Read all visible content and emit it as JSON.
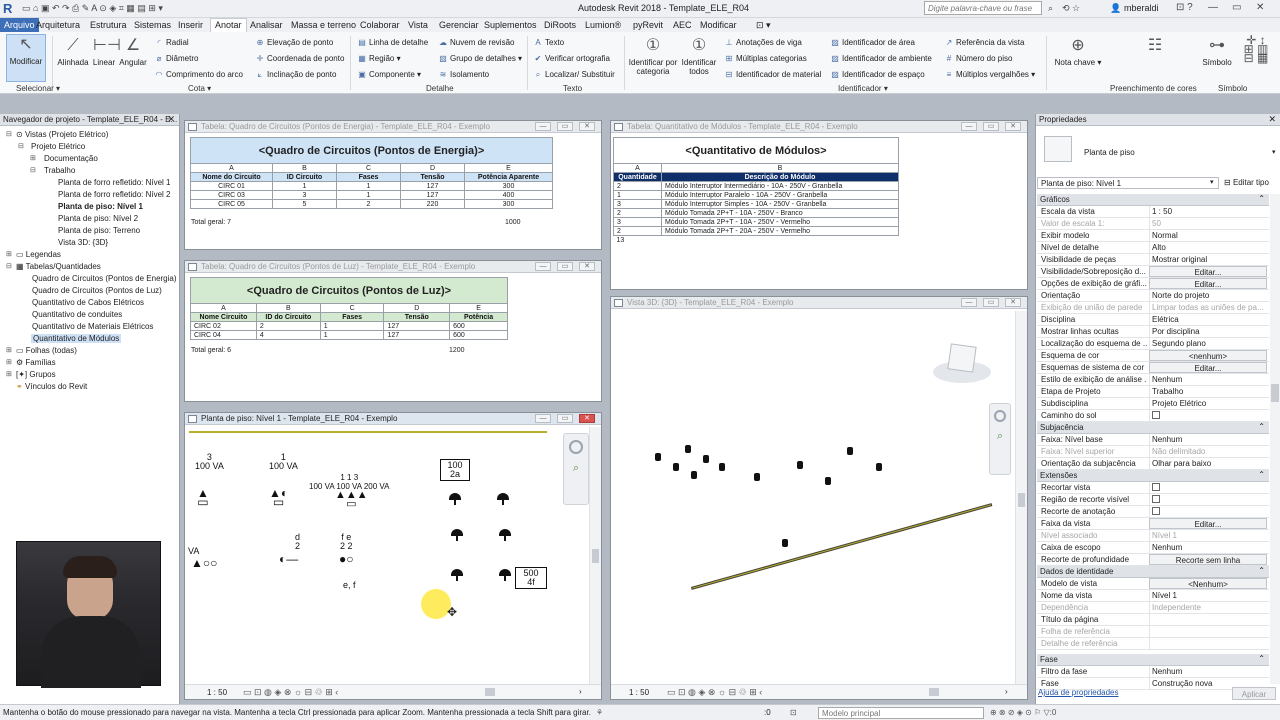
{
  "titlebar": {
    "app": "Autodesk Revit 2018 -",
    "file": "Template_ELE_R04",
    "search_placeholder": "Digite palavra-chave ou frase",
    "user": "mberaldi"
  },
  "tabs": [
    "Arquivo",
    "Arquitetura",
    "Estrutura",
    "Sistemas",
    "Inserir",
    "Anotar",
    "Analisar",
    "Massa e terreno",
    "Colaborar",
    "Vista",
    "Gerenciar",
    "Suplementos",
    "DiRoots",
    "Lumion®",
    "pyRevit",
    "AEC",
    "Modificar"
  ],
  "ribbon": {
    "modificar": "Modificar",
    "cota_btns": [
      "Alinhada",
      "Linear",
      "Angular"
    ],
    "cota_items": [
      "Radial",
      "Diâmetro",
      "Comprimento do arco",
      "Elevação de ponto",
      "Coordenada de ponto",
      "Inclinação de ponto"
    ],
    "detalhe_items": [
      "Linha de detalhe",
      "Região",
      "Componente",
      "Nuvem de revisão",
      "Grupo de detalhes",
      "Isolamento"
    ],
    "texto_items": [
      "Texto",
      "Verificar ortografia",
      "Localizar/ Substituir"
    ],
    "ident_btns": [
      "Identificar por categoria",
      "Identificar todos"
    ],
    "ident_items": [
      "Anotações de viga",
      "Múltiplas categorias",
      "Identificador de material",
      "Identificador de área",
      "Identificador de ambiente",
      "Identificador de espaço",
      "Referência da vista",
      "Número do piso",
      "Múltiplos vergalhões"
    ],
    "nota": "Nota chave",
    "simbolo": "Símbolo",
    "panels": [
      "Selecionar",
      "Cota",
      "Detalhe",
      "Texto",
      "Identificador",
      "Preenchimento de cores",
      "Símbolo"
    ]
  },
  "browser": {
    "title": "Navegador de projeto - Template_ELE_R04 - E...",
    "nodes": [
      "Vistas (Projeto Elétrico)",
      "Projeto Elétrico",
      "Documentação",
      "Trabalho",
      "Planta de forro refletido: Nível 1",
      "Planta de forro refletido: Nível 2",
      "Planta de piso: Nível 1",
      "Planta de piso: Nível 2",
      "Planta de piso: Terreno",
      "Vista 3D: {3D}",
      "Legendas",
      "Tabelas/Quantidades",
      "Quadro de Circuitos (Pontos de Energia)",
      "Quadro de Circuitos (Pontos de Luz)",
      "Quantitativo de Cabos Elétricos",
      "Quantitativo de conduites",
      "Quantitativo de Materiais Elétricos",
      "Quantitativo de Módulos",
      "Folhas (todas)",
      "Famílias",
      "Grupos",
      "Vínculos do Revit"
    ]
  },
  "view1": {
    "title": "Tabela: Quadro de Circuitos (Pontos de Energia) - Template_ELE_R04 - Exemplo",
    "caption": "<Quadro de Circuitos (Pontos de Energia)>",
    "letters": [
      "A",
      "B",
      "C",
      "D",
      "E"
    ],
    "headers": [
      "Nome do Circuito",
      "ID Circuito",
      "Fases",
      "Tensão",
      "Potência Aparente"
    ],
    "rows": [
      [
        "CIRC 01",
        "1",
        "1",
        "127",
        "300"
      ],
      [
        "CIRC 03",
        "3",
        "1",
        "127",
        "400"
      ],
      [
        "CIRC 05",
        "5",
        "2",
        "220",
        "300"
      ]
    ],
    "total_label": "Total geral: 7",
    "total_value": "1000",
    "color": "#cfe3f7"
  },
  "view2": {
    "title": "Tabela: Quadro de Circuitos (Pontos de Luz) - Template_ELE_R04 - Exemplo",
    "caption": "<Quadro de Circuitos (Pontos de Luz)>",
    "letters": [
      "A",
      "B",
      "C",
      "D",
      "E"
    ],
    "headers": [
      "Nome Circuito",
      "ID do Circuito",
      "Fases",
      "Tensão",
      "Potência"
    ],
    "rows": [
      [
        "CIRC 02",
        "2",
        "1",
        "127",
        "600"
      ],
      [
        "CIRC 04",
        "4",
        "1",
        "127",
        "600"
      ]
    ],
    "total_label": "Total geral: 6",
    "total_value": "1200",
    "color": "#d4ead0"
  },
  "view3": {
    "title": "Tabela: Quantitativo de Módulos - Template_ELE_R04 - Exemplo",
    "caption": "<Quantitativo de Módulos>",
    "letters": [
      "A",
      "B"
    ],
    "headers": [
      "Quantidade",
      "Descrição do Módulo"
    ],
    "rows": [
      [
        "2",
        "Módulo Interruptor Intermediário - 10A - 250V - Granbella"
      ],
      [
        "1",
        "Módulo Interruptor Paralelo - 10A - 250V - Granbella"
      ],
      [
        "3",
        "Módulo Interruptor Simples - 10A - 250V - Granbella"
      ],
      [
        "2",
        "Módulo Tomada 2P+T - 10A - 250V - Branco"
      ],
      [
        "3",
        "Módulo Tomada 2P+T - 10A - 250V - Vermelho"
      ],
      [
        "2",
        "Módulo Tomada 2P+T - 20A - 250V - Vermelho"
      ]
    ],
    "total_value": "13",
    "color": "#0f2f6b"
  },
  "view4": {
    "title": "Planta de piso: Nível 1 - Template_ELE_R04 - Exemplo",
    "scale": "1 : 50",
    "labels": {
      "a1": "3",
      "a2": "100 VA",
      "b1": "1",
      "b2": "100 VA",
      "c1": "1    1     3",
      "c2": "100 VA 100 VA 200 VA",
      "d1": "100",
      "d2": "2a",
      "e1": "d",
      "e2": "2",
      "f1": "f   e",
      "f2": "2  2",
      "f3": "e, f",
      "g1": "500",
      "g2": "4f",
      "h": "VA"
    }
  },
  "view5": {
    "title": "Vista 3D: {3D} - Template_ELE_R04 - Exemplo",
    "scale": "1 : 50"
  },
  "props": {
    "title": "Propriedades",
    "type": "Planta de piso",
    "instance": "Planta de piso: Nível 1",
    "edit_type": "Editar tipo",
    "groups": {
      "graficos": "Gráficos",
      "subjacencia": "Subjacência",
      "extensoes": "Extensões",
      "identidade": "Dados de identidade",
      "fase": "Fase"
    },
    "rows_graficos": [
      [
        "Escala da vista",
        "1 : 50",
        ""
      ],
      [
        "Valor de escala    1:",
        "50",
        "dis"
      ],
      [
        "Exibir modelo",
        "Normal",
        ""
      ],
      [
        "Nível de detalhe",
        "Alto",
        ""
      ],
      [
        "Visibilidade de peças",
        "Mostrar original",
        ""
      ],
      [
        "Visibilidade/Sobreposição d...",
        "Editar...",
        "btn"
      ],
      [
        "Opções de exibição de gráfi...",
        "Editar...",
        "btn"
      ],
      [
        "Orientação",
        "Norte do projeto",
        ""
      ],
      [
        "Exibição de união de parede",
        "Limpar todas as uniões de pa...",
        "dis"
      ],
      [
        "Disciplina",
        "Elétrica",
        ""
      ],
      [
        "Mostrar linhas ocultas",
        "Por disciplina",
        ""
      ],
      [
        "Localização do esquema de ...",
        "Segundo plano",
        ""
      ],
      [
        "Esquema de cor",
        "<nenhum>",
        "btn"
      ],
      [
        "Esquemas de sistema de cor",
        "Editar...",
        "btn"
      ],
      [
        "Estilo de exibição de análise ...",
        "Nenhum",
        ""
      ],
      [
        "Etapa de Projeto",
        "Trabalho",
        ""
      ],
      [
        "Subdisciplina",
        "Projeto Elétrico",
        ""
      ],
      [
        "Caminho do sol",
        "",
        "cb"
      ]
    ],
    "rows_subjacencia": [
      [
        "Faixa: Nível base",
        "Nenhum",
        ""
      ],
      [
        "Faixa: Nível superior",
        "Não delimitado",
        "dis"
      ],
      [
        "Orientação da subjacência",
        "Olhar para baixo",
        ""
      ]
    ],
    "rows_extensoes": [
      [
        "Recortar vista",
        "",
        "cb"
      ],
      [
        "Região de recorte visível",
        "",
        "cb"
      ],
      [
        "Recorte de anotação",
        "",
        "cb"
      ],
      [
        "Faixa da vista",
        "Editar...",
        "btn"
      ],
      [
        "Nível associado",
        "Nível 1",
        "dis"
      ],
      [
        "Caixa de escopo",
        "Nenhum",
        ""
      ],
      [
        "Recorte de profundidade",
        "Recorte sem linha",
        "btn"
      ]
    ],
    "rows_identidade": [
      [
        "Modelo de vista",
        "<Nenhum>",
        "btn"
      ],
      [
        "Nome da vista",
        "Nível 1",
        ""
      ],
      [
        "Dependência",
        "Independente",
        "dis"
      ],
      [
        "Título da página",
        "",
        ""
      ],
      [
        "Folha de referência",
        "",
        "dis"
      ],
      [
        "Detalhe de referência",
        "",
        "dis"
      ]
    ],
    "rows_fase": [
      [
        "Filtro da fase",
        "Nenhum",
        ""
      ],
      [
        "Fase",
        "Construção nova",
        ""
      ]
    ],
    "help": "Ajuda de propriedades",
    "apply": "Aplicar"
  },
  "status": {
    "hint": "Mantenha o botão do mouse pressionado para navegar na vista. Mantenha a tecla Ctrl pressionada para aplicar Zoom. Mantenha pressionada a tecla Shift para girar.",
    "zero": ":0",
    "model": "Modelo principal"
  }
}
